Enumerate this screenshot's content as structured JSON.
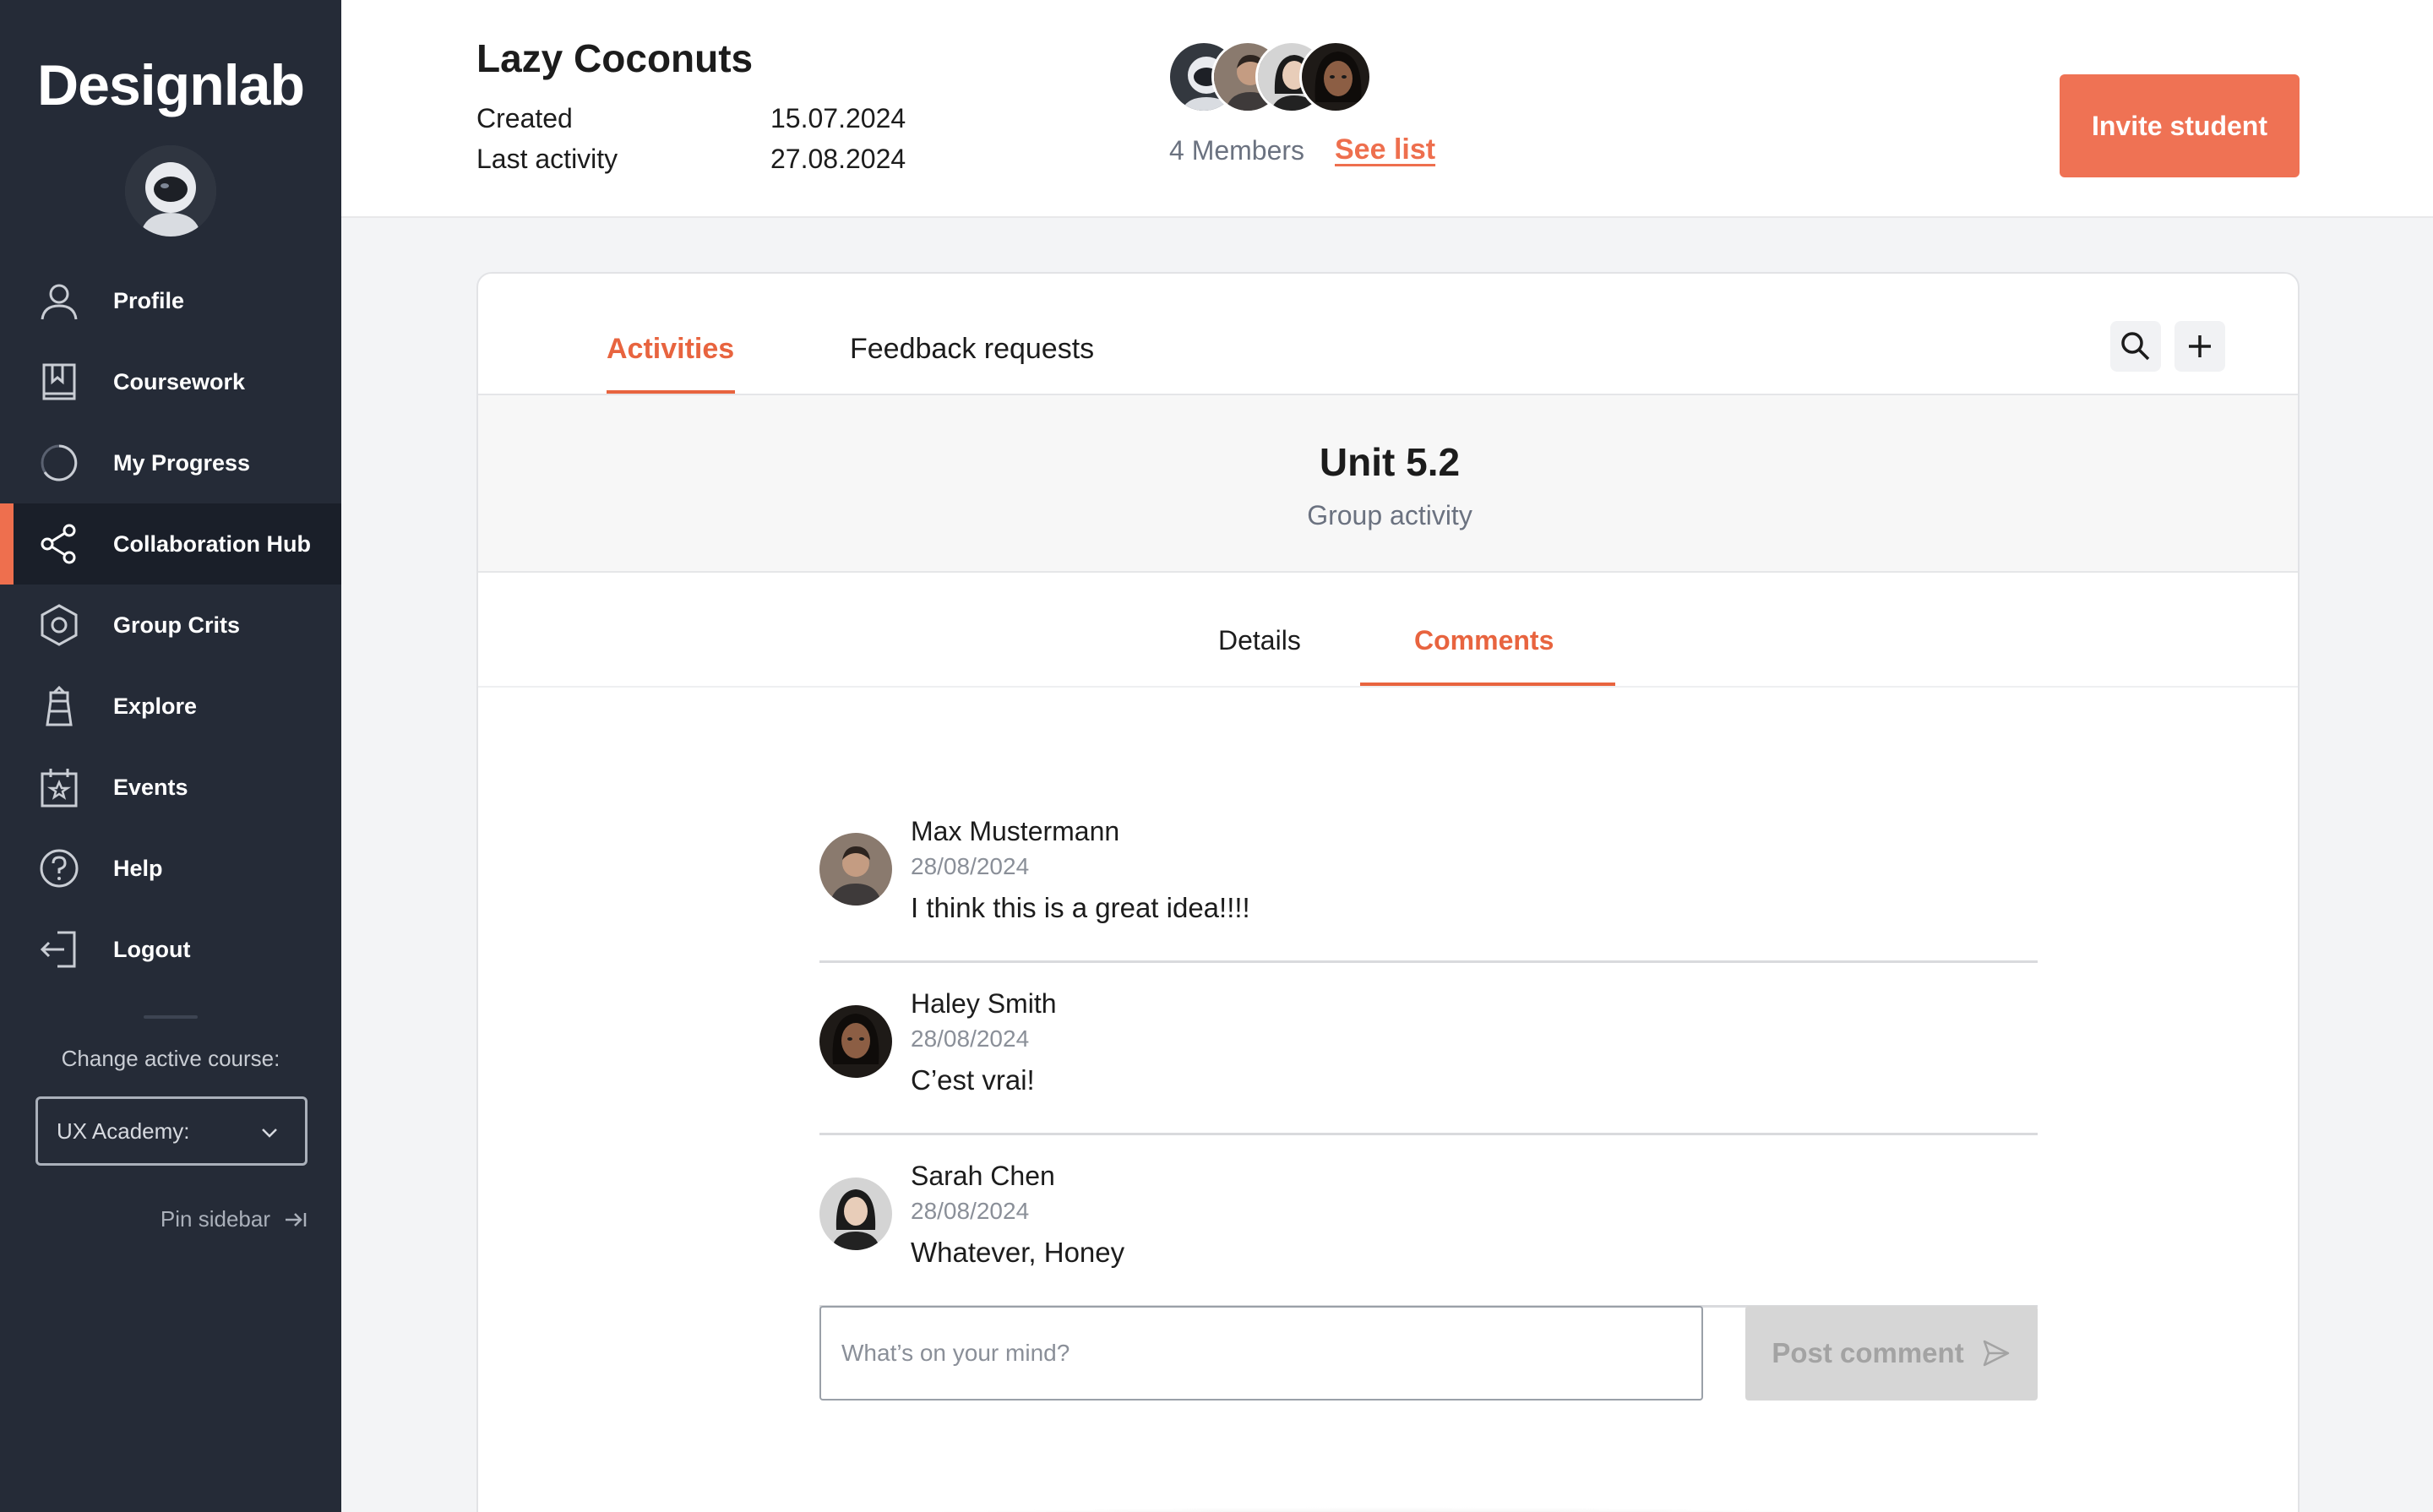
{
  "sidebar": {
    "logo": "Designlab",
    "nav": [
      {
        "label": "Profile",
        "icon": "user-icon"
      },
      {
        "label": "Coursework",
        "icon": "bookmark-book-icon"
      },
      {
        "label": "My Progress",
        "icon": "progress-ring-icon"
      },
      {
        "label": "Collaboration Hub",
        "icon": "share-nodes-icon",
        "active": true
      },
      {
        "label": "Group Crits",
        "icon": "hexagon-icon"
      },
      {
        "label": "Explore",
        "icon": "lighthouse-icon"
      },
      {
        "label": "Events",
        "icon": "calendar-star-icon"
      },
      {
        "label": "Help",
        "icon": "question-circle-icon"
      },
      {
        "label": "Logout",
        "icon": "logout-icon"
      }
    ],
    "change_course_label": "Change active course:",
    "course_value": "UX Academy:",
    "pin_label": "Pin sidebar"
  },
  "header": {
    "group_name": "Lazy Coconuts",
    "created_label": "Created",
    "created_value": "15.07.2024",
    "last_activity_label": "Last activity",
    "last_activity_value": "27.08.2024",
    "members_label": "4 Members",
    "see_list_label": "See list",
    "invite_label": "Invite student"
  },
  "tabs": [
    {
      "label": "Activities",
      "active": true
    },
    {
      "label": "Feedback requests",
      "active": false
    }
  ],
  "unit": {
    "title": "Unit 5.2",
    "subtitle": "Group activity"
  },
  "subtabs": [
    {
      "label": "Details",
      "active": false
    },
    {
      "label": "Comments",
      "active": true
    }
  ],
  "comments": [
    {
      "name": "Max Mustermann",
      "date": "28/08/2024",
      "text": "I think this is a great idea!!!!"
    },
    {
      "name": "Haley Smith",
      "date": "28/08/2024",
      "text": "C’est vrai!"
    },
    {
      "name": "Sarah Chen",
      "date": "28/08/2024",
      "text": "Whatever, Honey"
    }
  ],
  "composer": {
    "placeholder": "What’s on your mind?",
    "post_label": "Post comment"
  },
  "colors": {
    "accent": "#ee6f4e",
    "sidebar_bg": "#252b37",
    "sidebar_active_bg": "#1a1f29"
  }
}
